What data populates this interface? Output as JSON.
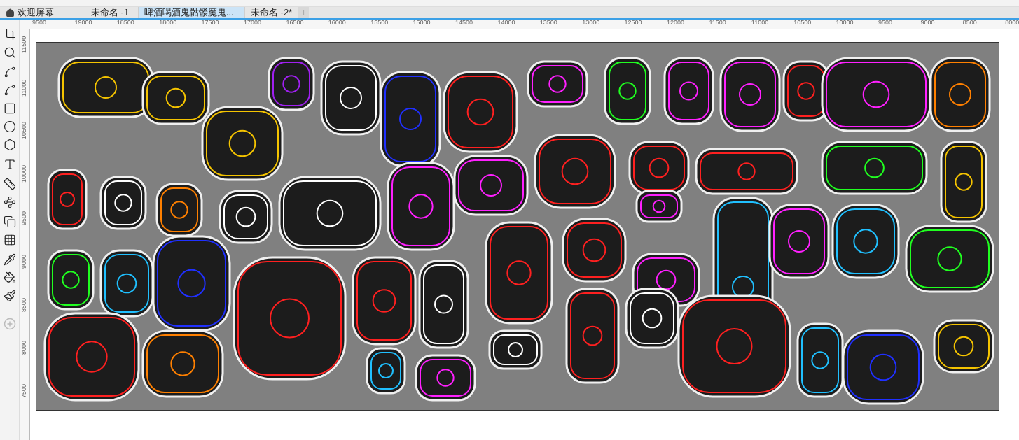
{
  "tabs": [
    {
      "label": "欢迎屏幕",
      "kind": "home",
      "selected": false
    },
    {
      "label": "未命名 -1",
      "kind": "doc",
      "selected": false
    },
    {
      "label": "啤酒喝酒鬼骷髅魔鬼...",
      "kind": "doc",
      "selected": true
    },
    {
      "label": "未命名 -2*",
      "kind": "doc",
      "selected": false
    }
  ],
  "new_tab": "+",
  "horizontal_ruler": [
    "9500",
    "19000",
    "18500",
    "18000",
    "17500",
    "17000",
    "16500",
    "16000",
    "15500",
    "15000",
    "14500",
    "14000",
    "13500",
    "13000",
    "12500",
    "12000",
    "11500",
    "11000",
    "10500",
    "10000",
    "9500",
    "9000",
    "8500",
    "8000"
  ],
  "vertical_ruler": [
    "11500",
    "11000",
    "10500",
    "10000",
    "9500",
    "9000",
    "8500",
    "8000",
    "7500"
  ]
}
